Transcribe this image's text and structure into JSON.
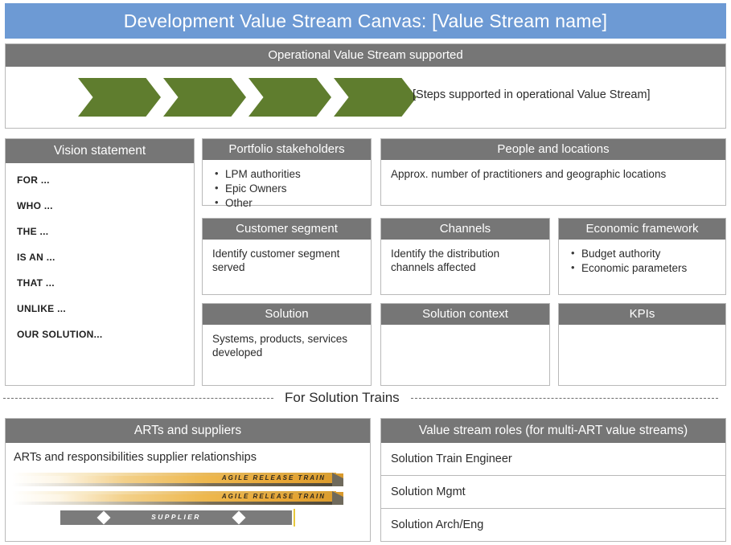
{
  "title": "Development Value Stream Canvas: [Value Stream name]",
  "operational": {
    "header": "Operational Value Stream supported",
    "steps_count": 4,
    "note": "[Steps supported in operational Value Stream]",
    "arrow_color": "#5f7d2e"
  },
  "vision": {
    "header": "Vision statement",
    "lines": [
      "FOR ...",
      "WHO ...",
      "THE ...",
      "IS AN ...",
      "THAT ...",
      "UNLIKE ...",
      "OUR SOLUTION..."
    ]
  },
  "stakeholders": {
    "header": "Portfolio stakeholders",
    "items": [
      "LPM authorities",
      "Epic Owners",
      "Other"
    ]
  },
  "people": {
    "header": "People and locations",
    "body": "Approx. number of practitioners and geographic locations"
  },
  "customer": {
    "header": "Customer  segment",
    "body": "Identify customer segment served"
  },
  "channels": {
    "header": "Channels",
    "body": "Identify the distribution channels affected"
  },
  "economic": {
    "header": "Economic framework",
    "items": [
      "Budget authority",
      "Economic parameters"
    ]
  },
  "solution": {
    "header": "Solution",
    "body": "Systems, products, services developed"
  },
  "solution_context": {
    "header": "Solution context",
    "body": ""
  },
  "kpis": {
    "header": "KPIs",
    "body": ""
  },
  "divider": {
    "label": "For Solution Trains"
  },
  "arts": {
    "header": "ARTs and suppliers",
    "body": "ARTs and responsibilities supplier relationships",
    "trains": [
      "AGILE RELEASE TRAIN",
      "AGILE RELEASE TRAIN"
    ],
    "supplier_label": "SUPPLIER"
  },
  "roles": {
    "header": "Value stream roles (for multi-ART value streams)",
    "rows": [
      "Solution Train Engineer",
      "Solution Mgmt",
      "Solution Arch/Eng"
    ]
  },
  "colors": {
    "title_bar": "#6d9ad4",
    "card_header": "#767676",
    "arrow": "#5f7d2e",
    "supplier_bar": "#7b7b7b"
  }
}
